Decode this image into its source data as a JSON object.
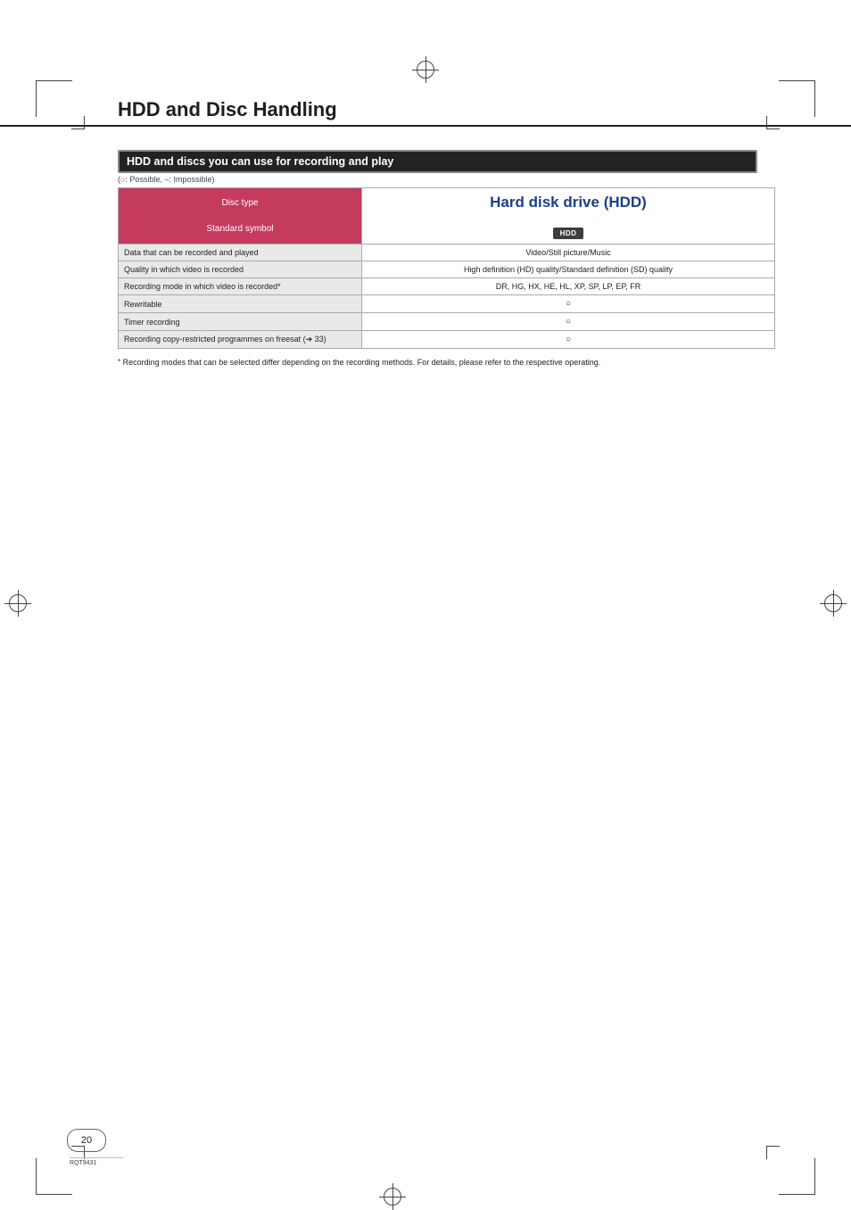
{
  "page": {
    "title": "HDD and Disc Handling",
    "section_bar": "HDD and discs you can use for recording and play",
    "legend": "(○: Possible, –: Impossible)",
    "footnote_marker": "*",
    "footnote": "Recording modes that can be selected differ depending on the recording methods. For details, please refer to the respective operating.",
    "page_number": "20",
    "doc_code": "RQT9431"
  },
  "table": {
    "left_header_top": "Disc type",
    "left_header_bottom": "Standard symbol",
    "right_header_title": "Hard disk drive (HDD)",
    "right_header_chip": "HDD",
    "rows": [
      {
        "label": "Data that can be recorded and played",
        "value": "Video/Still picture/Music"
      },
      {
        "label": "Quality in which video is recorded",
        "value": "High definition (HD) quality/Standard definition (SD) quality"
      },
      {
        "label": "Recording mode in which video is recorded*",
        "value": "DR, HG, HX, HE, HL, XP, SP, LP, EP, FR"
      },
      {
        "label": "Rewritable",
        "value": "○"
      },
      {
        "label": "Timer recording",
        "value": "○"
      },
      {
        "label": "Recording copy-restricted programmes on freesat (➔ 33)",
        "value": "○"
      }
    ]
  }
}
